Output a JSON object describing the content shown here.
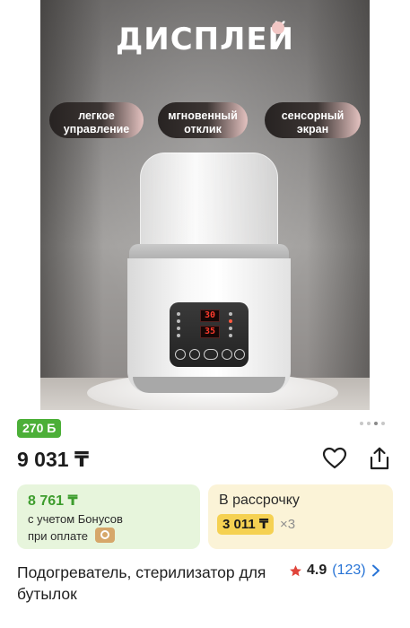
{
  "hero": {
    "title": "ДИСПЛЕЙ",
    "badges": [
      "легкое\nуправление",
      "мгновенный\nотклик",
      "сенсорный\nэкран"
    ],
    "display_readouts": [
      "30",
      "35"
    ]
  },
  "gallery": {
    "page_count": 4,
    "active_index": 2
  },
  "bonus_badge": "270 Б",
  "price": "9 031 ₸",
  "bonus_card": {
    "price": "8 761 ₸",
    "line1": "с учетом Бонусов",
    "line2": "при оплате"
  },
  "installment_card": {
    "label": "В рассрочку",
    "amount": "3 011 ₸",
    "multiplier": "×3"
  },
  "product": {
    "title": "Подогреватель, стерилизатор для бутылок",
    "rating": "4.9",
    "reviews": "(123)"
  },
  "colors": {
    "bonus_green": "#4caf38",
    "installment_yellow": "#f5d152",
    "link_blue": "#2874d6",
    "star_red": "#e0443a"
  }
}
